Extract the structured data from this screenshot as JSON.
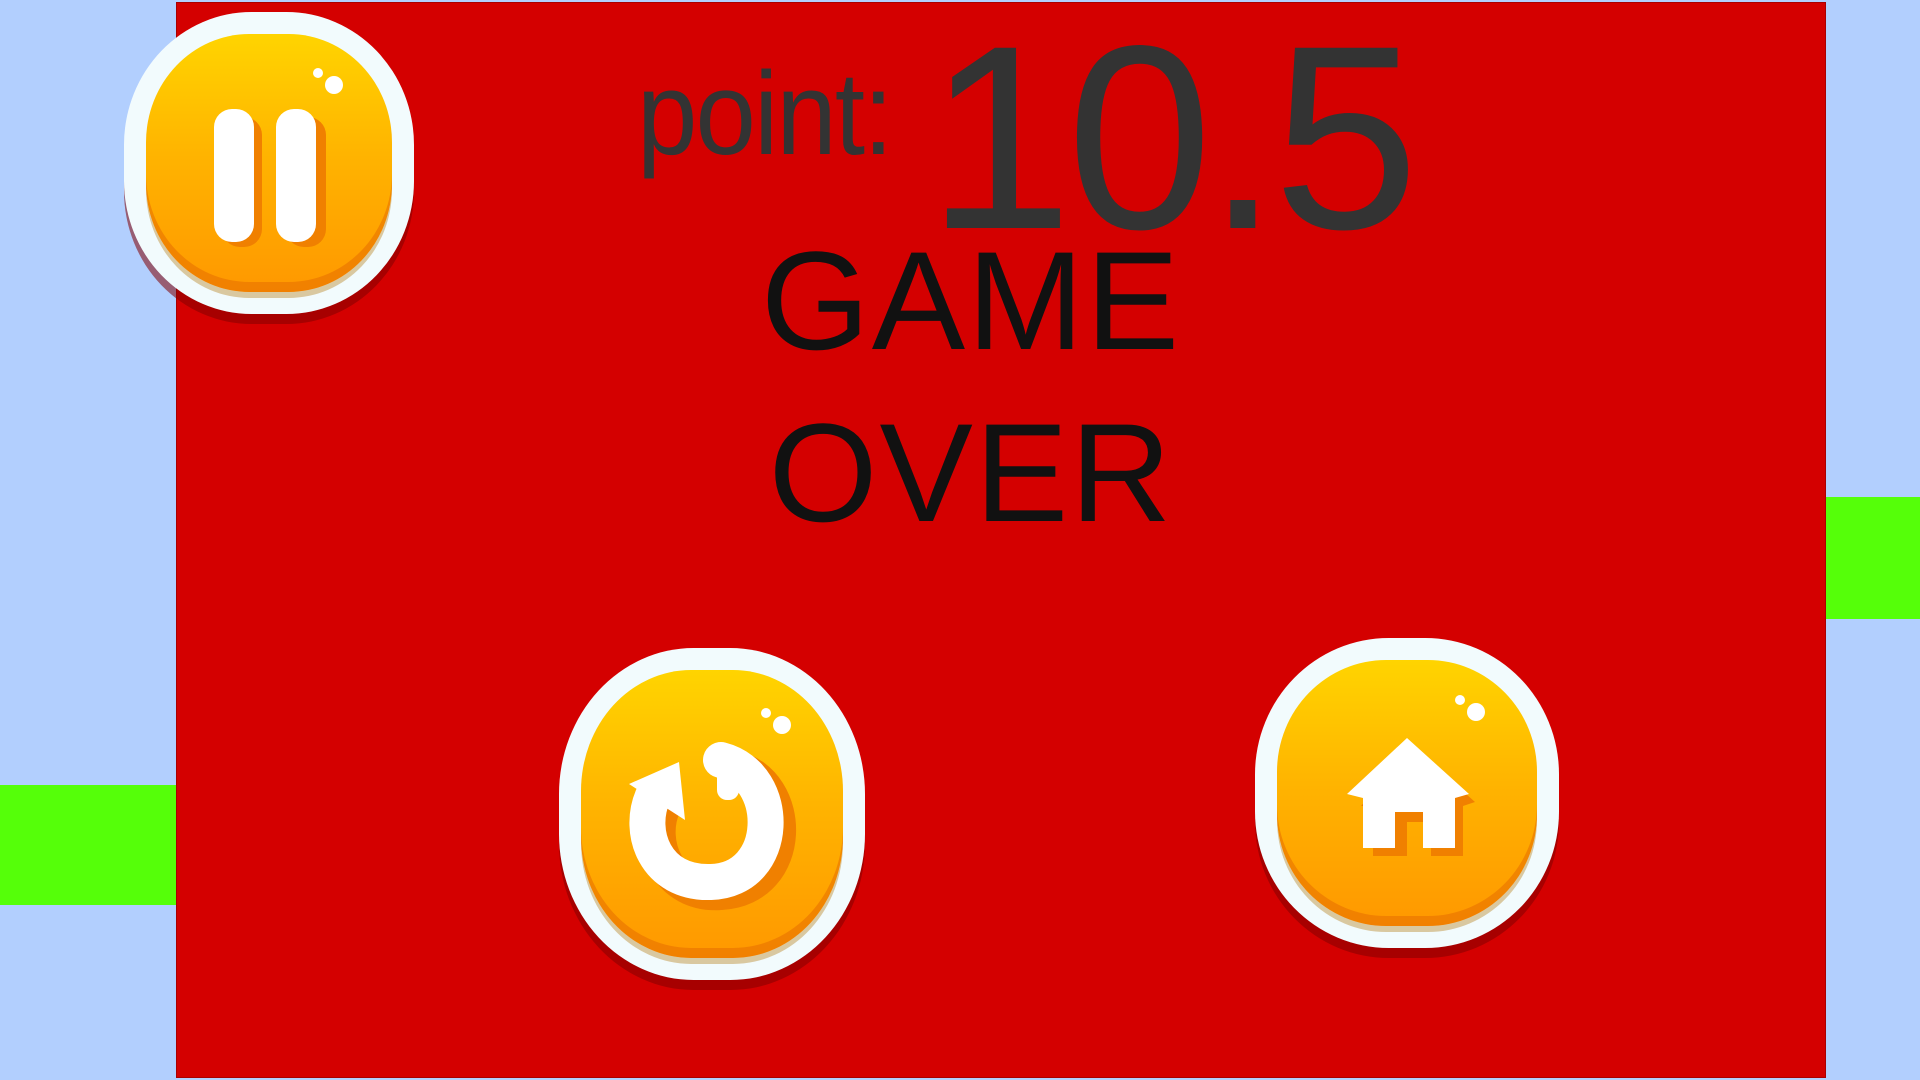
{
  "scene": {
    "background_color": "#b2cffe",
    "panel_color": "#d40000",
    "obstacle_color": "#55ff09"
  },
  "score": {
    "label": "point:",
    "value": "10.5"
  },
  "game_over": {
    "line1": "GAME",
    "line2": "OVER"
  },
  "buttons": {
    "pause": {
      "icon": "pause-icon"
    },
    "restart": {
      "icon": "restart-icon"
    },
    "home": {
      "icon": "home-icon"
    }
  }
}
